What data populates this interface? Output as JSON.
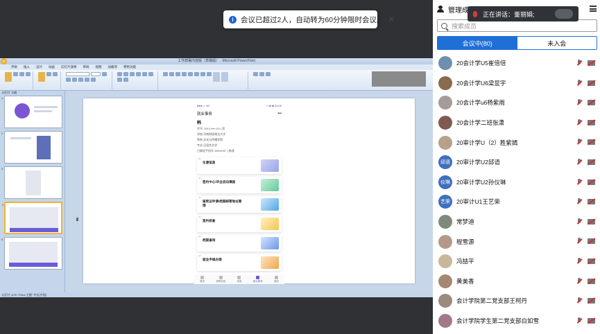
{
  "toast": {
    "text": "会议已超过2人，自动转为60分钟限时会议。"
  },
  "speaking": {
    "text": "正在讲话：董丽娟;"
  },
  "panel": {
    "title": "管理成员",
    "search_placeholder": "搜索成员",
    "tab_in_meeting": "会议中(80)",
    "tab_not_joined": "未入会"
  },
  "members": [
    {
      "name": "20会计学U5崔倍倍",
      "avatar_text": "",
      "color": "#6f8fb0"
    },
    {
      "name": "20会计学U6梁显宇",
      "avatar_text": "",
      "color": "#8b6b4d"
    },
    {
      "name": "20会计学u6杨紫雨",
      "avatar_text": "",
      "color": "#a59c9a"
    },
    {
      "name": "20会计学二班张潇",
      "avatar_text": "",
      "color": "#7f5a4e"
    },
    {
      "name": "20审计学U（2）胜紫嫣",
      "avatar_text": "",
      "color": "#b9a08a"
    },
    {
      "name": "20审计学U2邱语",
      "avatar_text": "邱语",
      "color": "#3f6fbe"
    },
    {
      "name": "20审计学U2孙仪琳",
      "avatar_text": "仪琳",
      "color": "#3f6fbe"
    },
    {
      "name": "20审计U1王艺荣",
      "avatar_text": "艺荣",
      "color": "#3f6fbe"
    },
    {
      "name": "常梦迪",
      "avatar_text": "",
      "color": "#7f8a7c"
    },
    {
      "name": "程雪源",
      "avatar_text": "",
      "color": "#b49a86"
    },
    {
      "name": "冯喆平",
      "avatar_text": "",
      "color": "#c9b79c"
    },
    {
      "name": "黄美香",
      "avatar_text": "",
      "color": "#a58873"
    },
    {
      "name": "会计学院第二党支部王柯丹",
      "avatar_text": "",
      "color": "#9b8a7d"
    },
    {
      "name": "会计学院学生第二党支部白如雪",
      "avatar_text": "",
      "color": "#a07a8a"
    }
  ],
  "ppt": {
    "title_bar": "工作部署内容版（草稿版） - Microsoft PowerPoint",
    "tabs": [
      "开始",
      "插入",
      "设计",
      "动画",
      "幻灯片放映",
      "审阅",
      "视图",
      "加载项",
      "特色功能"
    ],
    "thumb_tabs": "幻灯片  大纲",
    "status_bar": "幻灯片 4/25   \"Office 主题\"   中文(中国)",
    "slide_numbers": [
      "1",
      "2",
      "3",
      "4",
      "5"
    ],
    "phone": {
      "status_left": "●●●○○ 4G",
      "status_right": "▪ 98 ■ 20:00",
      "nav_title": "就业事务",
      "nav_more": "•••",
      "profile_name": "韩",
      "profile_line1": "学号: 2014 ▪▪▪▪   ▪24 | 男",
      "profile_line2": "学校:河南财经政法大学",
      "profile_line3": "院系:文化与传播学院",
      "profile_line4": "专业:汉语言文学",
      "profile_line5": "已绑定手机号 16▪▪▪▪▪▪57 | 修改",
      "services": [
        "生源信息",
        "签约中心\\毕业去向填报",
        "报到证申请\\档案邮寄地址管理",
        "签约核查",
        "档案查询",
        "就业手续办理"
      ],
      "tabbar": [
        "首页",
        "求职信息",
        "消息",
        "就业事务",
        "我的"
      ]
    }
  }
}
